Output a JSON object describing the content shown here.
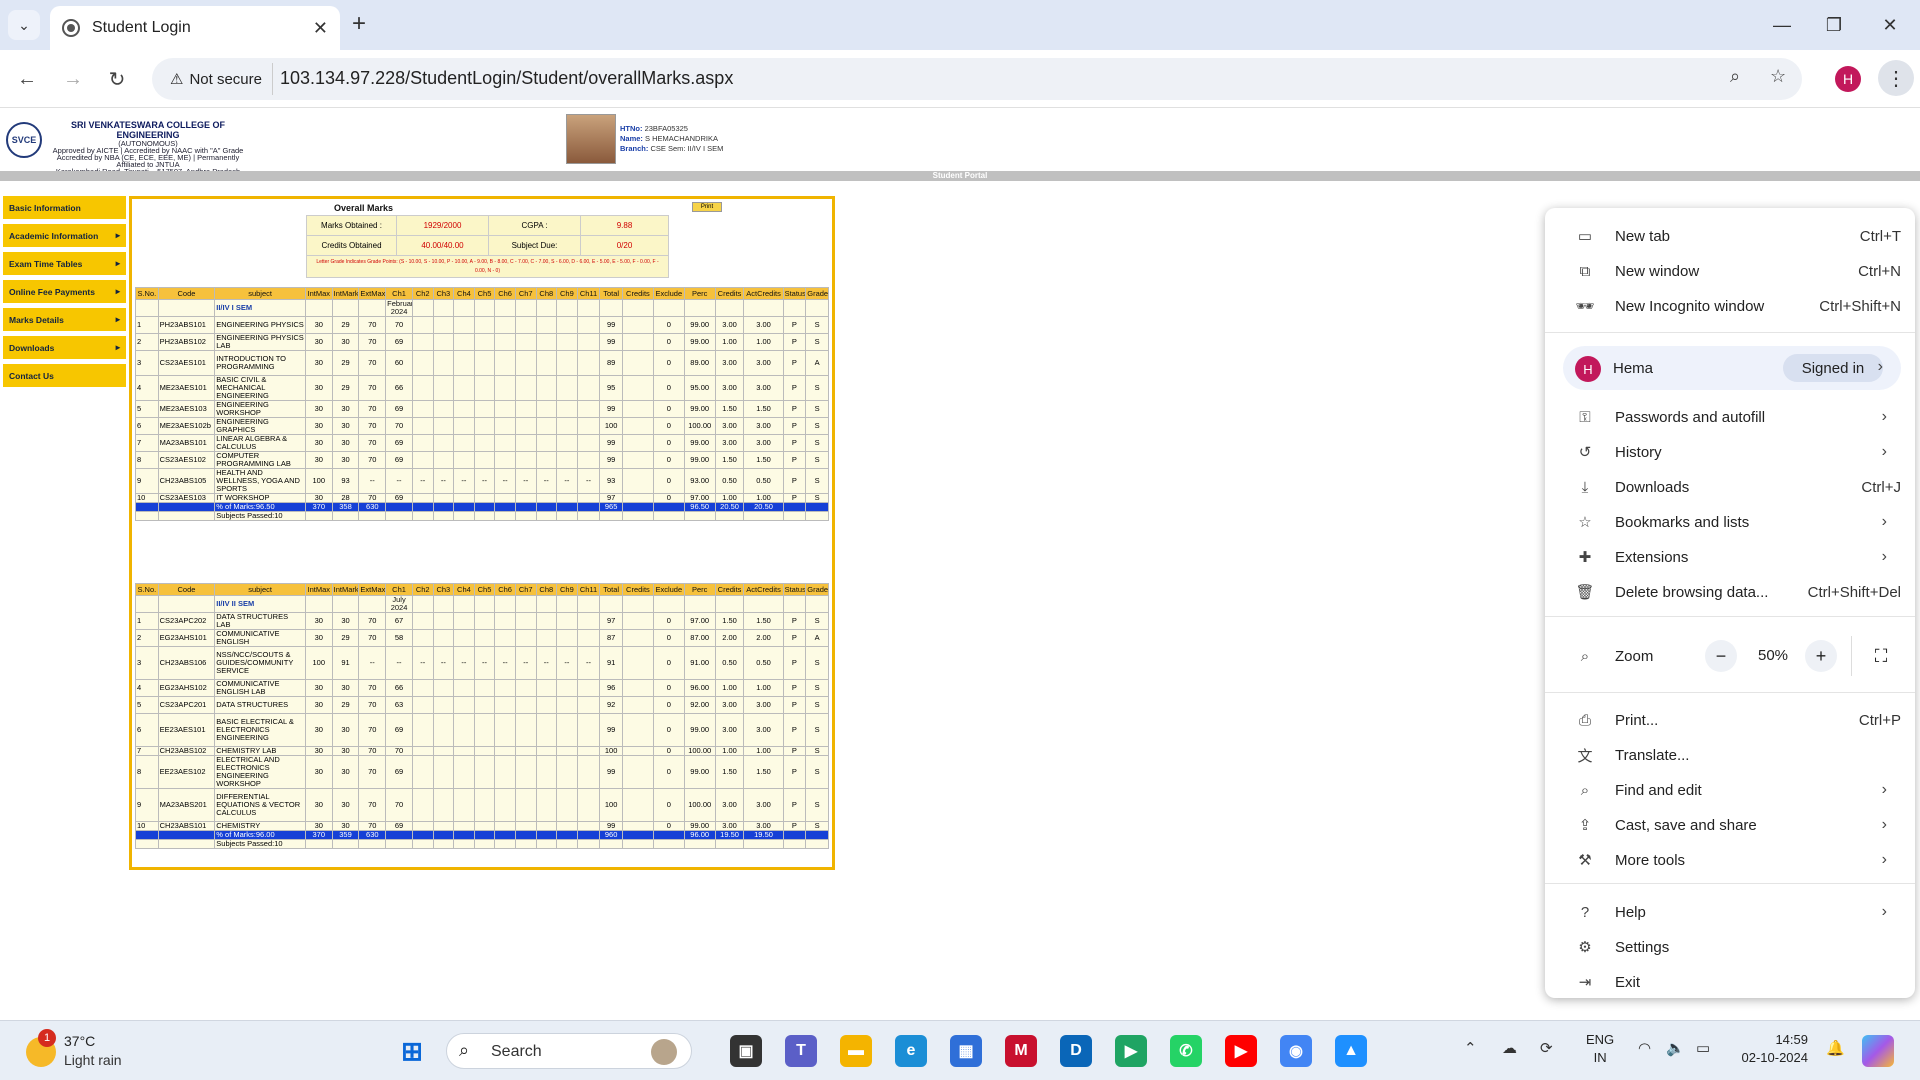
{
  "browser": {
    "tab_title": "Student Login",
    "not_secure": "Not secure",
    "url": "103.134.97.228/StudentLogin/Student/overallMarks.aspx",
    "profile_initial": "H"
  },
  "header": {
    "logo_text": "SVCE",
    "college_name": "SRI VENKATESWARA COLLEGE OF ENGINEERING",
    "autonomous": "(AUTONOMOUS)",
    "approval": "Approved by AICTE | Accredited by NAAC with \"A\" Grade",
    "accreditation": "Accredited by NBA (CE, ECE, EEE, ME) | Permanently Affiliated to JNTUA",
    "address": "Karakambadi Road, Tirupati – 517507, Andhra Pradesh",
    "htno_label": "HTNo:",
    "htno": "23BFA05325",
    "name_label": "Name:",
    "name": "S HEMACHANDRIKA",
    "branch_label": "Branch:",
    "branch": "CSE Sem: II/IV I SEM",
    "portal_title": "Student Portal"
  },
  "sidemenu": [
    "Basic Information",
    "Academic Information",
    "Exam Time Tables",
    "Online Fee Payments",
    "Marks Details",
    "Downloads",
    "Contact Us"
  ],
  "sidemenu_arrows": [
    false,
    true,
    true,
    true,
    true,
    true,
    false
  ],
  "marks": {
    "title": "Overall Marks",
    "print": "Print",
    "marks_obtained_label": "Marks Obtained :",
    "marks_obtained": "1929/2000",
    "cgpa_label": "CGPA :",
    "cgpa": "9.88",
    "credits_label": "Credits Obtained",
    "credits": "40.00/40.00",
    "due_label": "Subject Due:",
    "due": "0/20",
    "note": "Letter Grade Indicates Grade Points: (S - 10.00, S - 10.00, P - 10.00, A - 9.00, B - 8.00, C - 7.00, C - 7.00, S - 6.00, D - 6.00, E - 5.00, E - 5.00, F - 0.00, F - 0.00, N - 0)"
  },
  "columns": [
    "S.No.",
    "Code",
    "subject",
    "IntMax",
    "IntMarks",
    "ExtMax",
    "Ch1",
    "Ch2",
    "Ch3",
    "Ch4",
    "Ch5",
    "Ch6",
    "Ch7",
    "Ch8",
    "Ch9",
    "Ch11",
    "Total",
    "Credits",
    "Exclude",
    "Perc",
    "Credits",
    "ActCredits",
    "Status",
    "Grade"
  ],
  "semesters": [
    {
      "exam": "February 2024",
      "sem": "II/IV I SEM",
      "rows": [
        [
          "1",
          "PH23ABS101",
          "ENGINEERING PHYSICS",
          "30",
          "29",
          "70",
          "70",
          "",
          "",
          "",
          "",
          "",
          "",
          "",
          "",
          "",
          "99",
          "0",
          "99.00",
          "3.00",
          "3.00",
          "P",
          "S"
        ],
        [
          "2",
          "PH23ABS102",
          "ENGINEERING PHYSICS LAB",
          "30",
          "30",
          "70",
          "69",
          "",
          "",
          "",
          "",
          "",
          "",
          "",
          "",
          "",
          "99",
          "0",
          "99.00",
          "1.00",
          "1.00",
          "P",
          "S"
        ],
        [
          "3",
          "CS23AES101",
          "INTRODUCTION TO PROGRAMMING",
          "30",
          "29",
          "70",
          "60",
          "",
          "",
          "",
          "",
          "",
          "",
          "",
          "",
          "",
          "89",
          "0",
          "89.00",
          "3.00",
          "3.00",
          "P",
          "A"
        ],
        [
          "4",
          "ME23AES101",
          "BASIC CIVIL & MECHANICAL ENGINEERING",
          "30",
          "29",
          "70",
          "66",
          "",
          "",
          "",
          "",
          "",
          "",
          "",
          "",
          "",
          "95",
          "0",
          "95.00",
          "3.00",
          "3.00",
          "P",
          "S"
        ],
        [
          "5",
          "ME23AES103",
          "ENGINEERING WORKSHOP",
          "30",
          "30",
          "70",
          "69",
          "",
          "",
          "",
          "",
          "",
          "",
          "",
          "",
          "",
          "99",
          "0",
          "99.00",
          "1.50",
          "1.50",
          "P",
          "S"
        ],
        [
          "6",
          "ME23AES102b",
          "ENGINEERING GRAPHICS",
          "30",
          "30",
          "70",
          "70",
          "",
          "",
          "",
          "",
          "",
          "",
          "",
          "",
          "",
          "100",
          "0",
          "100.00",
          "3.00",
          "3.00",
          "P",
          "S"
        ],
        [
          "7",
          "MA23ABS101",
          "LINEAR ALGEBRA & CALCULUS",
          "30",
          "30",
          "70",
          "69",
          "",
          "",
          "",
          "",
          "",
          "",
          "",
          "",
          "",
          "99",
          "0",
          "99.00",
          "3.00",
          "3.00",
          "P",
          "S"
        ],
        [
          "8",
          "CS23AES102",
          "COMPUTER PROGRAMMING LAB",
          "30",
          "30",
          "70",
          "69",
          "",
          "",
          "",
          "",
          "",
          "",
          "",
          "",
          "",
          "99",
          "0",
          "99.00",
          "1.50",
          "1.50",
          "P",
          "S"
        ],
        [
          "9",
          "CH23ABS105",
          "HEALTH AND WELLNESS, YOGA AND SPORTS",
          "100",
          "93",
          "--",
          "--",
          "--",
          "--",
          "--",
          "--",
          "--",
          "--",
          "--",
          "--",
          "--",
          "93",
          "0",
          "93.00",
          "0.50",
          "0.50",
          "P",
          "S"
        ],
        [
          "10",
          "CS23AES103",
          "IT WORKSHOP",
          "30",
          "28",
          "70",
          "69",
          "",
          "",
          "",
          "",
          "",
          "",
          "",
          "",
          "",
          "97",
          "0",
          "97.00",
          "1.00",
          "1.00",
          "P",
          "S"
        ]
      ],
      "total": {
        "label": "% of Marks:96.50",
        "intmax": "370",
        "intmarks": "358",
        "extmax": "630",
        "total": "965",
        "perc": "96.50",
        "credits": "20.50",
        "act": "20.50"
      },
      "passed": "Subjects Passed:10"
    },
    {
      "exam": "July 2024",
      "sem": "II/IV II SEM",
      "rows": [
        [
          "1",
          "CS23APC202",
          "DATA STRUCTURES LAB",
          "30",
          "30",
          "70",
          "67",
          "",
          "",
          "",
          "",
          "",
          "",
          "",
          "",
          "",
          "97",
          "0",
          "97.00",
          "1.50",
          "1.50",
          "P",
          "S"
        ],
        [
          "2",
          "EG23AHS101",
          "COMMUNICATIVE ENGLISH",
          "30",
          "29",
          "70",
          "58",
          "",
          "",
          "",
          "",
          "",
          "",
          "",
          "",
          "",
          "87",
          "0",
          "87.00",
          "2.00",
          "2.00",
          "P",
          "A"
        ],
        [
          "3",
          "CH23ABS106",
          "NSS/NCC/SCOUTS & GUIDES/COMMUNITY SERVICE",
          "100",
          "91",
          "--",
          "--",
          "--",
          "--",
          "--",
          "--",
          "--",
          "--",
          "--",
          "--",
          "--",
          "91",
          "0",
          "91.00",
          "0.50",
          "0.50",
          "P",
          "S"
        ],
        [
          "4",
          "EG23AHS102",
          "COMMUNICATIVE ENGLISH LAB",
          "30",
          "30",
          "70",
          "66",
          "",
          "",
          "",
          "",
          "",
          "",
          "",
          "",
          "",
          "96",
          "0",
          "96.00",
          "1.00",
          "1.00",
          "P",
          "S"
        ],
        [
          "5",
          "CS23APC201",
          "DATA STRUCTURES",
          "30",
          "29",
          "70",
          "63",
          "",
          "",
          "",
          "",
          "",
          "",
          "",
          "",
          "",
          "92",
          "0",
          "92.00",
          "3.00",
          "3.00",
          "P",
          "S"
        ],
        [
          "6",
          "EE23AES101",
          "BASIC ELECTRICAL & ELECTRONICS ENGINEERING",
          "30",
          "30",
          "70",
          "69",
          "",
          "",
          "",
          "",
          "",
          "",
          "",
          "",
          "",
          "99",
          "0",
          "99.00",
          "3.00",
          "3.00",
          "P",
          "S"
        ],
        [
          "7",
          "CH23ABS102",
          "CHEMISTRY LAB",
          "30",
          "30",
          "70",
          "70",
          "",
          "",
          "",
          "",
          "",
          "",
          "",
          "",
          "",
          "100",
          "0",
          "100.00",
          "1.00",
          "1.00",
          "P",
          "S"
        ],
        [
          "8",
          "EE23AES102",
          "ELECTRICAL AND ELECTRONICS ENGINEERING WORKSHOP",
          "30",
          "30",
          "70",
          "69",
          "",
          "",
          "",
          "",
          "",
          "",
          "",
          "",
          "",
          "99",
          "0",
          "99.00",
          "1.50",
          "1.50",
          "P",
          "S"
        ],
        [
          "9",
          "MA23ABS201",
          "DIFFERENTIAL EQUATIONS & VECTOR CALCULUS",
          "30",
          "30",
          "70",
          "70",
          "",
          "",
          "",
          "",
          "",
          "",
          "",
          "",
          "",
          "100",
          "0",
          "100.00",
          "3.00",
          "3.00",
          "P",
          "S"
        ],
        [
          "10",
          "CH23ABS101",
          "CHEMISTRY",
          "30",
          "30",
          "70",
          "69",
          "",
          "",
          "",
          "",
          "",
          "",
          "",
          "",
          "",
          "99",
          "0",
          "99.00",
          "3.00",
          "3.00",
          "P",
          "S"
        ]
      ],
      "total": {
        "label": "% of Marks:96.00",
        "intmax": "370",
        "intmarks": "359",
        "extmax": "630",
        "total": "960",
        "perc": "96.00",
        "credits": "19.50",
        "act": "19.50"
      },
      "passed": "Subjects Passed:10"
    }
  ],
  "chrome_menu": {
    "items1": [
      {
        "icon": "new-tab-icon",
        "glyph": "▭",
        "label": "New tab",
        "shortcut": "Ctrl+T"
      },
      {
        "icon": "new-window-icon",
        "glyph": "⧉",
        "label": "New window",
        "shortcut": "Ctrl+N"
      },
      {
        "icon": "incognito-icon",
        "glyph": "🕶",
        "label": "New Incognito window",
        "shortcut": "Ctrl+Shift+N"
      }
    ],
    "account": {
      "initial": "H",
      "name": "Hema",
      "status": "Signed in"
    },
    "items2": [
      {
        "icon": "key-icon",
        "glyph": "⚿",
        "label": "Passwords and autofill",
        "arrow": true
      },
      {
        "icon": "history-icon",
        "glyph": "↺",
        "label": "History",
        "arrow": true
      },
      {
        "icon": "download-icon",
        "glyph": "⤓",
        "label": "Downloads",
        "shortcut": "Ctrl+J"
      },
      {
        "icon": "star-icon",
        "glyph": "☆",
        "label": "Bookmarks and lists",
        "arrow": true
      },
      {
        "icon": "puzzle-icon",
        "glyph": "✚",
        "label": "Extensions",
        "arrow": true
      },
      {
        "icon": "trash-icon",
        "glyph": "🗑",
        "label": "Delete browsing data...",
        "shortcut": "Ctrl+Shift+Del"
      }
    ],
    "zoom": {
      "label": "Zoom",
      "value": "50%"
    },
    "items3": [
      {
        "icon": "print-icon",
        "glyph": "⎙",
        "label": "Print...",
        "shortcut": "Ctrl+P"
      },
      {
        "icon": "translate-icon",
        "glyph": "文",
        "label": "Translate..."
      },
      {
        "icon": "find-icon",
        "glyph": "⌕",
        "label": "Find and edit",
        "arrow": true
      },
      {
        "icon": "cast-icon",
        "glyph": "⇪",
        "label": "Cast, save and share",
        "arrow": true
      },
      {
        "icon": "toolbox-icon",
        "glyph": "⚒",
        "label": "More tools",
        "arrow": true
      }
    ],
    "items4": [
      {
        "icon": "help-icon",
        "glyph": "?",
        "label": "Help",
        "arrow": true
      },
      {
        "icon": "settings-icon",
        "glyph": "⚙",
        "label": "Settings"
      },
      {
        "icon": "exit-icon",
        "glyph": "⇥",
        "label": "Exit"
      }
    ]
  },
  "taskbar": {
    "weather_badge": "1",
    "temp": "37°C",
    "condition": "Light rain",
    "search": "Search",
    "lang1": "ENG",
    "lang2": "IN",
    "time": "14:59",
    "date": "02-10-2024",
    "apps": [
      {
        "name": "task-view-icon",
        "color": "#333333",
        "glyph": "▣"
      },
      {
        "name": "teams-icon",
        "color": "#5b5fc7",
        "glyph": "T"
      },
      {
        "name": "file-explorer-icon",
        "color": "#f4b400",
        "glyph": "▬"
      },
      {
        "name": "edge-icon",
        "color": "#1b8ed6",
        "glyph": "e"
      },
      {
        "name": "store-icon",
        "color": "#2f6fd8",
        "glyph": "▦"
      },
      {
        "name": "mcafee-icon",
        "color": "#c8102e",
        "glyph": "M"
      },
      {
        "name": "dell-icon",
        "color": "#0a66b8",
        "glyph": "D"
      },
      {
        "name": "play-store-icon",
        "color": "#1fa463",
        "glyph": "▶"
      },
      {
        "name": "whatsapp-icon",
        "color": "#25d366",
        "glyph": "✆"
      },
      {
        "name": "youtube-icon",
        "color": "#ff0000",
        "glyph": "▶"
      },
      {
        "name": "chrome-icon",
        "color": "#4285f4",
        "glyph": "◉"
      },
      {
        "name": "photos-icon",
        "color": "#1e90ff",
        "glyph": "▲"
      }
    ]
  }
}
